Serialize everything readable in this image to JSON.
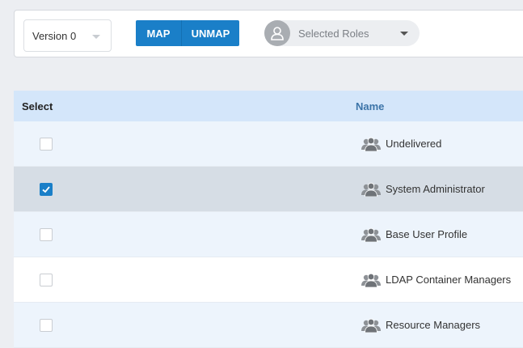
{
  "toolbar": {
    "version_select": {
      "value": "Version 0",
      "icon": "chevron-down-icon"
    },
    "map_label": "MAP",
    "unmap_label": "UNMAP",
    "roles_select": {
      "placeholder": "Selected Roles",
      "icon": "user-icon"
    }
  },
  "colors": {
    "accent": "#1a7fc8",
    "header_bg": "#d4e6fa",
    "row_alt_bg": "#edf4fc",
    "row_selected_bg": "#d6dde5",
    "page_bg": "#eceef2"
  },
  "grid": {
    "columns": {
      "select": "Select",
      "name": "Name"
    },
    "rows": [
      {
        "name": "Undelivered",
        "checked": false,
        "selected": false,
        "icon": "group-icon"
      },
      {
        "name": "System Administrator",
        "checked": true,
        "selected": true,
        "icon": "group-icon"
      },
      {
        "name": "Base User Profile",
        "checked": false,
        "selected": false,
        "icon": "group-icon"
      },
      {
        "name": "LDAP Container Managers",
        "checked": false,
        "selected": false,
        "icon": "group-icon"
      },
      {
        "name": "Resource Managers",
        "checked": false,
        "selected": false,
        "icon": "group-icon"
      }
    ]
  }
}
